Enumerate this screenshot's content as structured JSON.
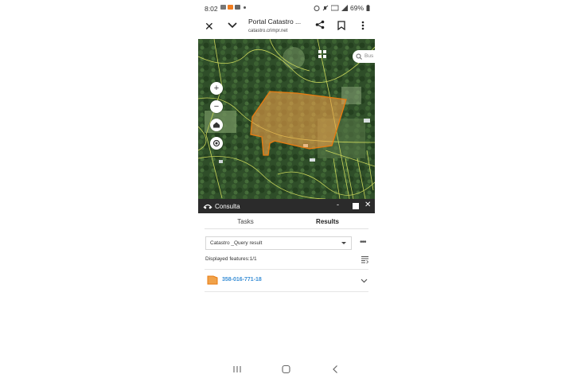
{
  "status_bar": {
    "time": "8:02",
    "battery": "69%"
  },
  "browser": {
    "page_title": "Portal Catastro ...",
    "url": "catastro.crimpr.net"
  },
  "map": {
    "search_placeholder": "Bus",
    "parcel_fill_color": "#f0a24a",
    "parcel_stroke_color": "#e87b10",
    "zoom_in_label": "+",
    "zoom_out_label": "−"
  },
  "panel": {
    "title": "Consulta",
    "minimize_label": "-",
    "close_label": "✕",
    "tabs": [
      {
        "label": "Tasks",
        "active": false
      },
      {
        "label": "Results",
        "active": true
      }
    ],
    "dropdown_value": "Catastro _Query result",
    "more_label": "•••",
    "displayed_features": "Displayed features:1/1",
    "results": [
      {
        "id": "358-016-771-18"
      }
    ]
  },
  "colors": {
    "accent": "#3a8fd6",
    "panel_header_bg": "#2b2b2b"
  }
}
